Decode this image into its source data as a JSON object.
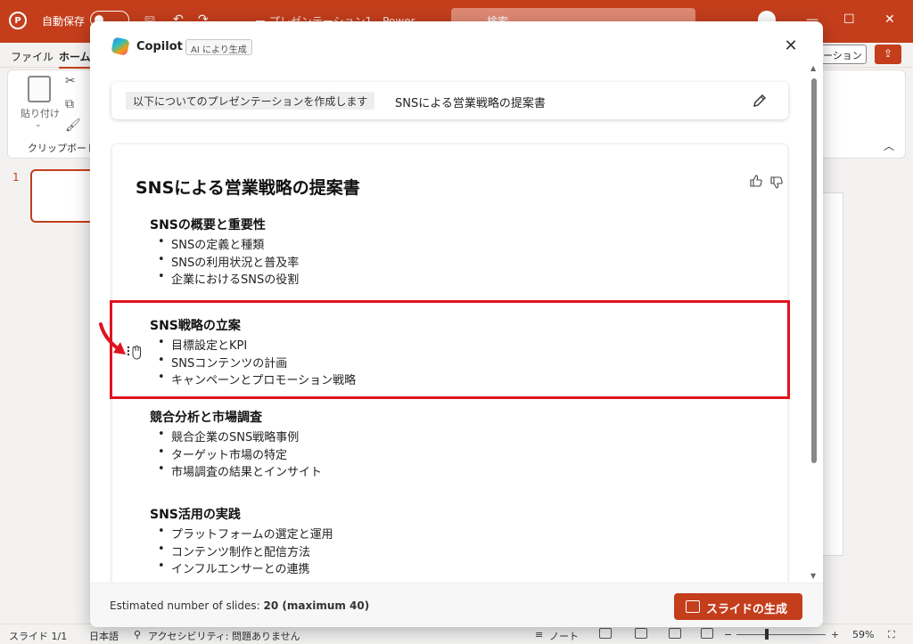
{
  "titlebar": {
    "autosave_label": "自動保存",
    "doc_title": "ー プレゼンテーション1 - Power",
    "search_placeholder": "検索",
    "minimize": "—",
    "maximize": "☐",
    "close": "✕"
  },
  "menu": {
    "tabs": [
      "ファイル",
      "ホーム"
    ],
    "present_label": "ーション",
    "share_symbol": "⇪"
  },
  "ribbon": {
    "paste_label": "貼り付け",
    "clipboard_group": "クリップボード",
    "collapse_symbol": "︿"
  },
  "workspace": {
    "slide_number": "1"
  },
  "dialog": {
    "title": "Copilot",
    "ai_badge": "AI により生成",
    "prompt_prefix": "以下についてのプレゼンテーションを作成します",
    "prompt_text": "SNSによる営業戦略の提案書",
    "outline_title": "SNSによる営業戦略の提案書",
    "sections": [
      {
        "title": "SNSの概要と重要性",
        "items": [
          "SNSの定義と種類",
          "SNSの利用状況と普及率",
          "企業におけるSNSの役割"
        ]
      },
      {
        "title": "SNS戦略の立案",
        "items": [
          "目標設定とKPI",
          "SNSコンテンツの計画",
          "キャンペーンとプロモーション戦略"
        ]
      },
      {
        "title": "競合分析と市場調査",
        "items": [
          "競合企業のSNS戦略事例",
          "ターゲット市場の特定",
          "市場調査の結果とインサイト"
        ]
      },
      {
        "title": "SNS活用の実践",
        "items": [
          "プラットフォームの選定と運用",
          "コンテンツ制作と配信方法",
          "インフルエンサーとの連携"
        ]
      }
    ],
    "footer_prefix": "Estimated number of slides: ",
    "footer_count": "20",
    "footer_suffix": " (maximum 40)",
    "generate_button": "スライドの生成"
  },
  "statusbar": {
    "slide": "スライド 1/1",
    "language": "日本語",
    "accessibility": "アクセシビリティ: 問題ありません",
    "notes": "ノート",
    "zoom": "59%"
  },
  "colors": {
    "accent": "#c43e1c",
    "highlight": "#e0131f"
  }
}
